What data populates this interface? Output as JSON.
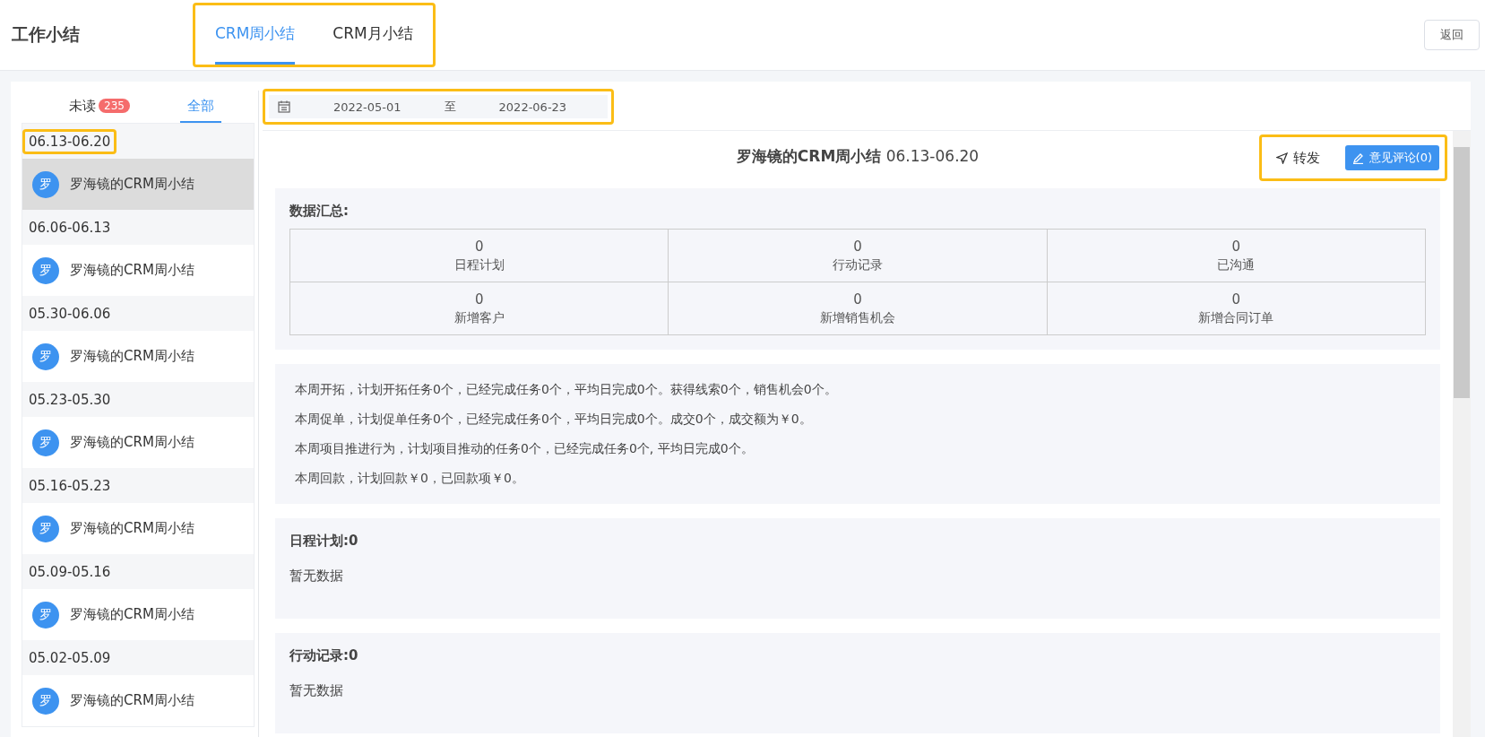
{
  "header": {
    "title": "工作小结",
    "tabs": [
      {
        "label": "CRM周小结",
        "selected": true
      },
      {
        "label": "CRM月小结",
        "selected": false
      }
    ],
    "back_button": "返回"
  },
  "sidebar": {
    "filters": [
      {
        "label": "未读",
        "badge": "235",
        "selected": false
      },
      {
        "label": "全部",
        "selected": true
      }
    ],
    "groups": [
      {
        "period": "06.13-06.20",
        "highlighted": true,
        "items": [
          {
            "avatar": "罗",
            "title": "罗海镜的CRM周小结",
            "selected": true
          }
        ]
      },
      {
        "period": "06.06-06.13",
        "highlighted": false,
        "items": [
          {
            "avatar": "罗",
            "title": "罗海镜的CRM周小结",
            "selected": false
          }
        ]
      },
      {
        "period": "05.30-06.06",
        "highlighted": false,
        "items": [
          {
            "avatar": "罗",
            "title": "罗海镜的CRM周小结",
            "selected": false
          }
        ]
      },
      {
        "period": "05.23-05.30",
        "highlighted": false,
        "items": [
          {
            "avatar": "罗",
            "title": "罗海镜的CRM周小结",
            "selected": false
          }
        ]
      },
      {
        "period": "05.16-05.23",
        "highlighted": false,
        "items": [
          {
            "avatar": "罗",
            "title": "罗海镜的CRM周小结",
            "selected": false
          }
        ]
      },
      {
        "period": "05.09-05.16",
        "highlighted": false,
        "items": [
          {
            "avatar": "罗",
            "title": "罗海镜的CRM周小结",
            "selected": false
          }
        ]
      },
      {
        "period": "05.02-05.09",
        "highlighted": false,
        "items": [
          {
            "avatar": "罗",
            "title": "罗海镜的CRM周小结",
            "selected": false
          }
        ]
      }
    ]
  },
  "date_range": {
    "start": "2022-05-01",
    "separator": "至",
    "end": "2022-06-23"
  },
  "report": {
    "title": "罗海镜的CRM周小结",
    "period": "06.13-06.20",
    "forward": "转发",
    "comment_button": "意见评论(0)",
    "summary": {
      "heading": "数据汇总:",
      "cells": [
        {
          "value": "0",
          "label": "日程计划"
        },
        {
          "value": "0",
          "label": "行动记录"
        },
        {
          "value": "0",
          "label": "已沟通"
        },
        {
          "value": "0",
          "label": "新增客户"
        },
        {
          "value": "0",
          "label": "新增销售机会"
        },
        {
          "value": "0",
          "label": "新增合同订单"
        }
      ]
    },
    "lines": [
      "本周开拓，计划开拓任务0个，已经完成任务0个，平均日完成0个。获得线索0个，销售机会0个。",
      "本周促单，计划促单任务0个，已经完成任务0个，平均日完成0个。成交0个，成交额为￥0。",
      "本周项目推进行为，计划项目推动的任务0个，已经完成任务0个, 平均日完成0个。",
      "本周回款，计划回款￥0，已回款项￥0。"
    ],
    "sections": [
      {
        "heading": "日程计划:0",
        "empty": "暂无数据"
      },
      {
        "heading": "行动记录:0",
        "empty": "暂无数据"
      }
    ]
  }
}
